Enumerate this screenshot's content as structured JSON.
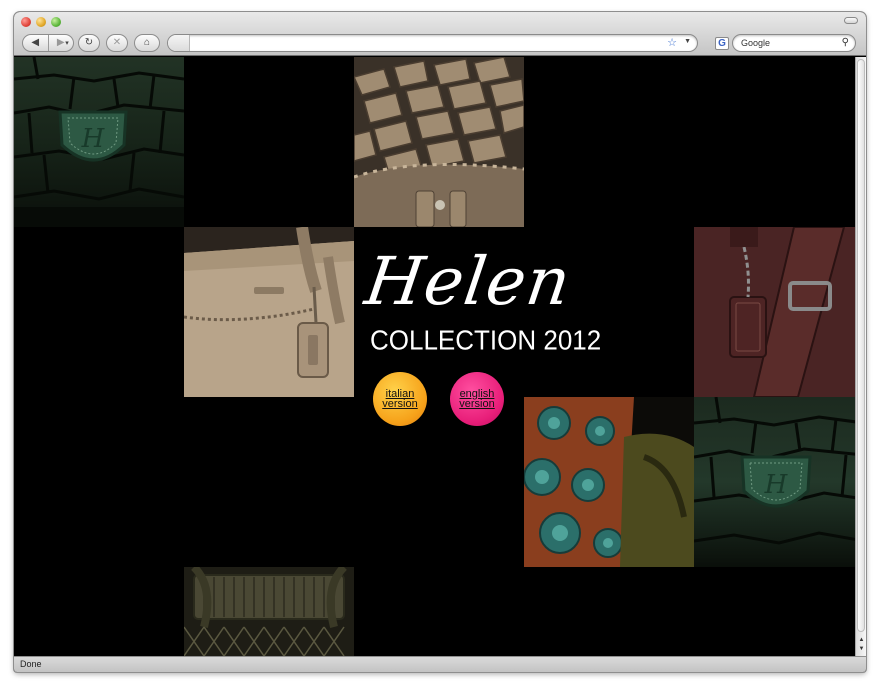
{
  "browser": {
    "search_placeholder": "Google",
    "search_engine_glyph": "G",
    "status_text": "Done",
    "colors": {
      "chrome_top": "#e9e9e9",
      "chrome_bottom": "#c5c5c5",
      "page_bg": "#000000"
    }
  },
  "page": {
    "logo": "Helen",
    "subtitle": "COLLECTION 2012",
    "languages": [
      {
        "label_line1": "italian",
        "label_line2": "version",
        "color": "#f6a21a"
      },
      {
        "label_line1": "english",
        "label_line2": "version",
        "color": "#e81e79"
      }
    ],
    "tiles": [
      {
        "name": "green crocodile leather with H emblem"
      },
      {
        "name": "woven taupe leather"
      },
      {
        "name": "taupe handbag with tag"
      },
      {
        "name": "burgundy leather bag with buckle"
      },
      {
        "name": "green crocodile leather with H emblem"
      },
      {
        "name": "teal and rust floral scarf"
      },
      {
        "name": "olive quilted leather bag"
      }
    ]
  }
}
